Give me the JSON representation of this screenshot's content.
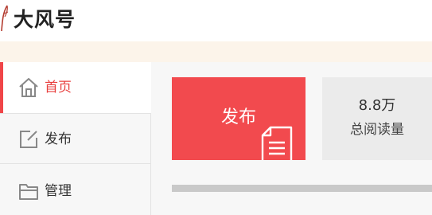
{
  "header": {
    "logo_text": "大风号"
  },
  "sidebar": {
    "items": [
      {
        "label": "首页",
        "icon": "home-icon",
        "active": true
      },
      {
        "label": "发布",
        "icon": "edit-icon",
        "active": false
      },
      {
        "label": "管理",
        "icon": "folder-icon",
        "active": false
      }
    ]
  },
  "main": {
    "publish_card": {
      "label": "发布",
      "icon": "document-icon"
    },
    "stats": [
      {
        "value": "8.8万",
        "label": "总阅读量"
      }
    ]
  },
  "colors": {
    "accent": "#f04548",
    "publish_card_bg": "#f24a4e",
    "stat_card_bg": "#ebebeb",
    "notice_bg": "#fcf4ea"
  }
}
